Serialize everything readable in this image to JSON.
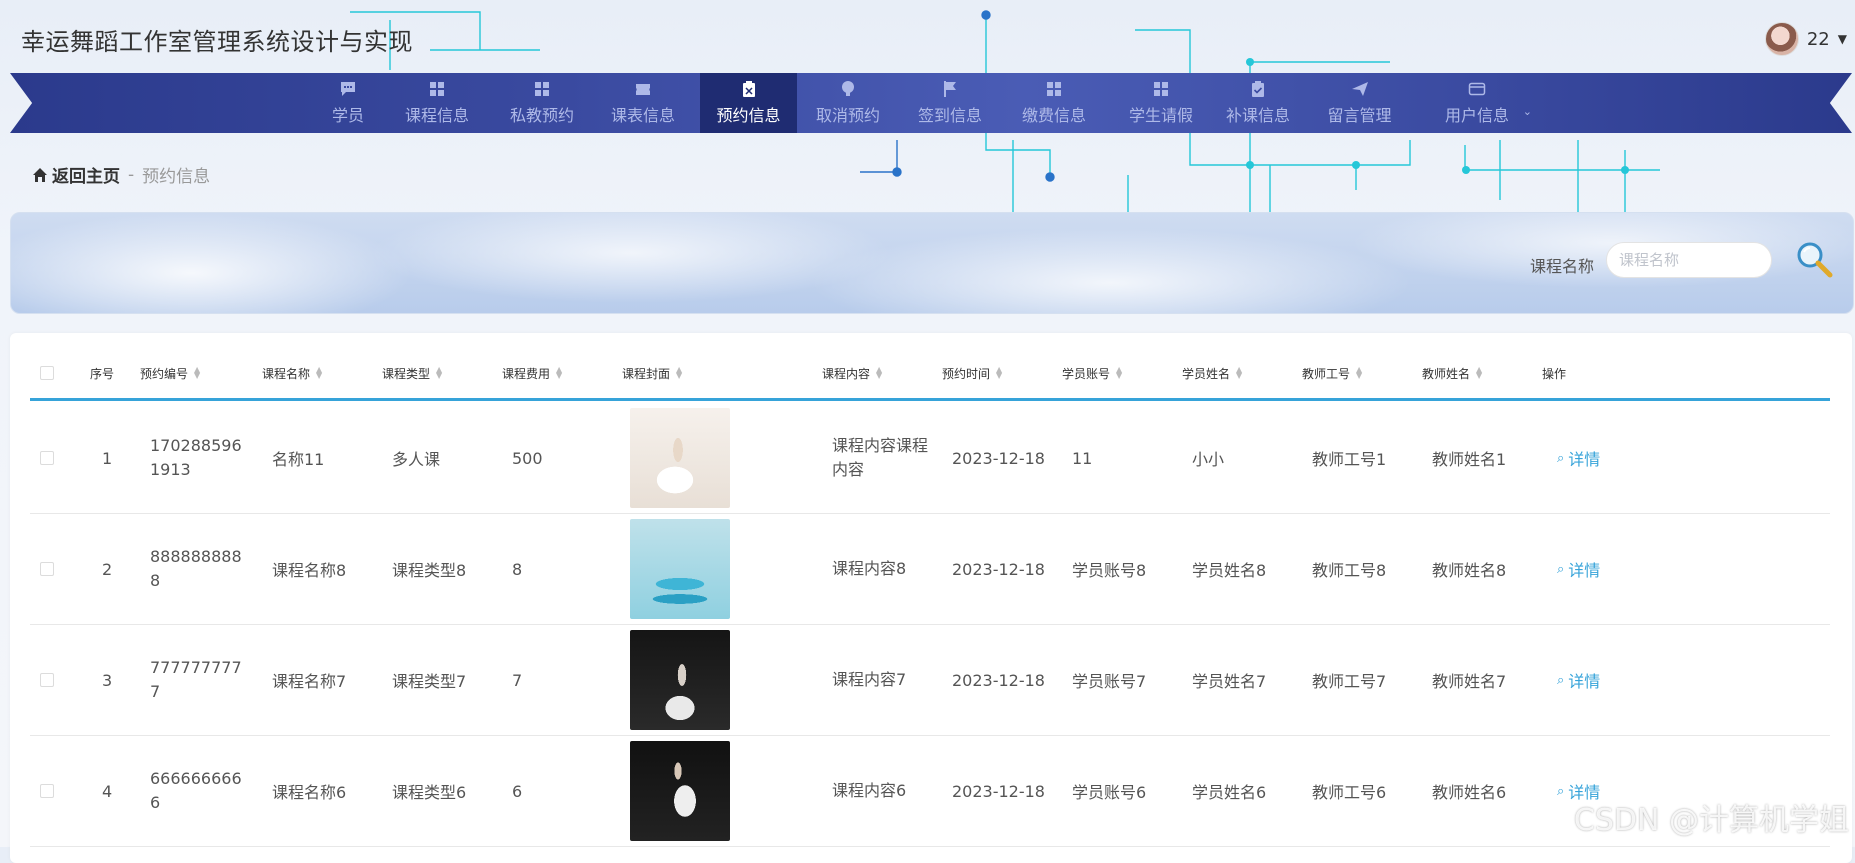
{
  "app": {
    "title": "幸运舞蹈工作室管理系统设计与实现"
  },
  "user": {
    "name": "22"
  },
  "nav": {
    "items": [
      {
        "label": "学员",
        "icon": "chat-icon"
      },
      {
        "label": "课程信息",
        "icon": "grid-icon"
      },
      {
        "label": "私教预约",
        "icon": "grid-icon"
      },
      {
        "label": "课表信息",
        "icon": "ticket-icon"
      },
      {
        "label": "预约信息",
        "icon": "clipboard-x-icon",
        "active": true
      },
      {
        "label": "取消预约",
        "icon": "bulb-icon"
      },
      {
        "label": "签到信息",
        "icon": "flag-icon"
      },
      {
        "label": "缴费信息",
        "icon": "grid-icon"
      },
      {
        "label": "学生请假",
        "icon": "grid-icon"
      },
      {
        "label": "补课信息",
        "icon": "clipboard-check-icon"
      },
      {
        "label": "留言管理",
        "icon": "send-icon"
      },
      {
        "label": "用户信息",
        "icon": "card-icon"
      }
    ]
  },
  "breadcrumb": {
    "home": "返回主页",
    "separator": "-",
    "current": "预约信息"
  },
  "search": {
    "label": "课程名称",
    "placeholder": "课程名称",
    "value": ""
  },
  "table": {
    "headers": [
      "序号",
      "预约编号",
      "课程名称",
      "课程类型",
      "课程费用",
      "课程封面",
      "课程内容",
      "预约时间",
      "学员账号",
      "学员姓名",
      "教师工号",
      "教师姓名",
      "操作"
    ],
    "rows": [
      {
        "index": "1",
        "booking_no": "1702885961913",
        "course_name": "名称11",
        "course_type": "多人课",
        "fee": "500",
        "content": "课程内容课程内容",
        "time": "2023-12-18",
        "student_account": "11",
        "student_name": "小小",
        "teacher_id": "教师工号1",
        "teacher_name": "教师姓名1",
        "action": "详情"
      },
      {
        "index": "2",
        "booking_no": "8888888888",
        "course_name": "课程名称8",
        "course_type": "课程类型8",
        "fee": "8",
        "content": "课程内容8",
        "time": "2023-12-18",
        "student_account": "学员账号8",
        "student_name": "学员姓名8",
        "teacher_id": "教师工号8",
        "teacher_name": "教师姓名8",
        "action": "详情"
      },
      {
        "index": "3",
        "booking_no": "7777777777",
        "course_name": "课程名称7",
        "course_type": "课程类型7",
        "fee": "7",
        "content": "课程内容7",
        "time": "2023-12-18",
        "student_account": "学员账号7",
        "student_name": "学员姓名7",
        "teacher_id": "教师工号7",
        "teacher_name": "教师姓名7",
        "action": "详情"
      },
      {
        "index": "4",
        "booking_no": "6666666666",
        "course_name": "课程名称6",
        "course_type": "课程类型6",
        "fee": "6",
        "content": "课程内容6",
        "time": "2023-12-18",
        "student_account": "学员账号6",
        "student_name": "学员姓名6",
        "teacher_id": "教师工号6",
        "teacher_name": "教师姓名6",
        "action": "详情"
      }
    ]
  },
  "watermark": "CSDN @计算机学姐",
  "colors": {
    "nav_bg": "#3a4aa0",
    "nav_active": "#1f2c72",
    "accent": "#36a3d9"
  }
}
